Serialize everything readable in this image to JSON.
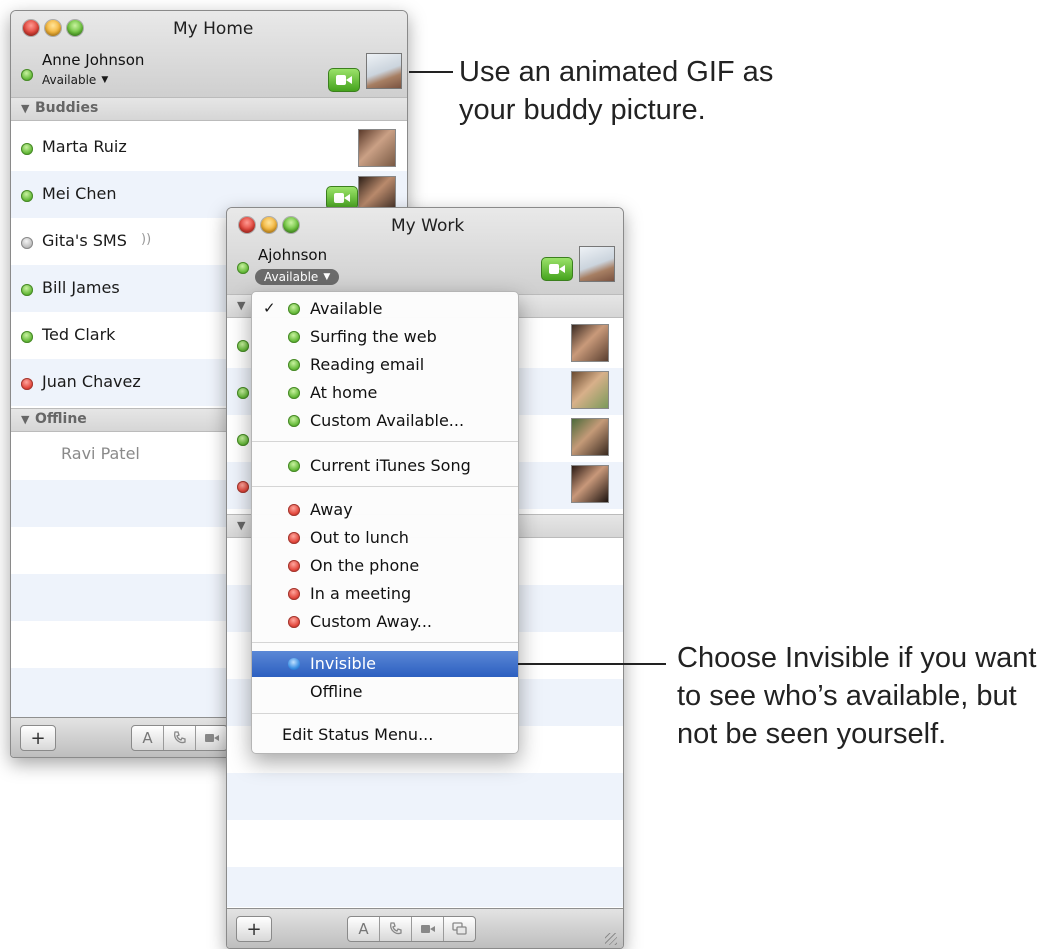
{
  "colors": {
    "available": "#62b836",
    "away": "#e04237",
    "offline": "#bcbcbc",
    "selected": "#2c5fc0"
  },
  "home_window": {
    "title": "My Home",
    "user": {
      "name": "Anne Johnson",
      "status": "Available"
    },
    "groups": {
      "buddies": "Buddies",
      "offline": "Offline"
    },
    "buddies": [
      {
        "name": "Marta Ruiz",
        "status": "available",
        "icon": "photo"
      },
      {
        "name": "Mei Chen",
        "status": "available",
        "icon": "video+photo"
      },
      {
        "name": "Gita's SMS",
        "status": "offline",
        "icon": "sms-wave"
      },
      {
        "name": "Bill James",
        "status": "available"
      },
      {
        "name": "Ted Clark",
        "status": "available"
      },
      {
        "name": "Juan Chavez",
        "status": "away"
      }
    ],
    "offline_buddies": [
      {
        "name": "Ravi Patel"
      }
    ],
    "toolbar": {
      "add": "+",
      "text": "A"
    }
  },
  "work_window": {
    "title": "My Work",
    "user": {
      "name": "Ajohnson",
      "status": "Available"
    },
    "toolbar": {
      "add": "+",
      "text": "A"
    }
  },
  "status_menu": {
    "available_items": [
      "Available",
      "Surfing the web",
      "Reading email",
      "At home",
      "Custom Available..."
    ],
    "itunes_item": "Current iTunes Song",
    "away_items": [
      "Away",
      "Out to lunch",
      "On the phone",
      "In a meeting",
      "Custom Away..."
    ],
    "invisible": "Invisible",
    "offline": "Offline",
    "edit": "Edit Status Menu...",
    "checked": "Available",
    "highlighted": "Invisible"
  },
  "callouts": {
    "gif_line1": "Use an animated GIF as",
    "gif_line2": "your buddy picture.",
    "invisible_line1": "Choose Invisible if you want",
    "invisible_line2": "to see who’s available, but",
    "invisible_line3": "not be seen yourself."
  }
}
